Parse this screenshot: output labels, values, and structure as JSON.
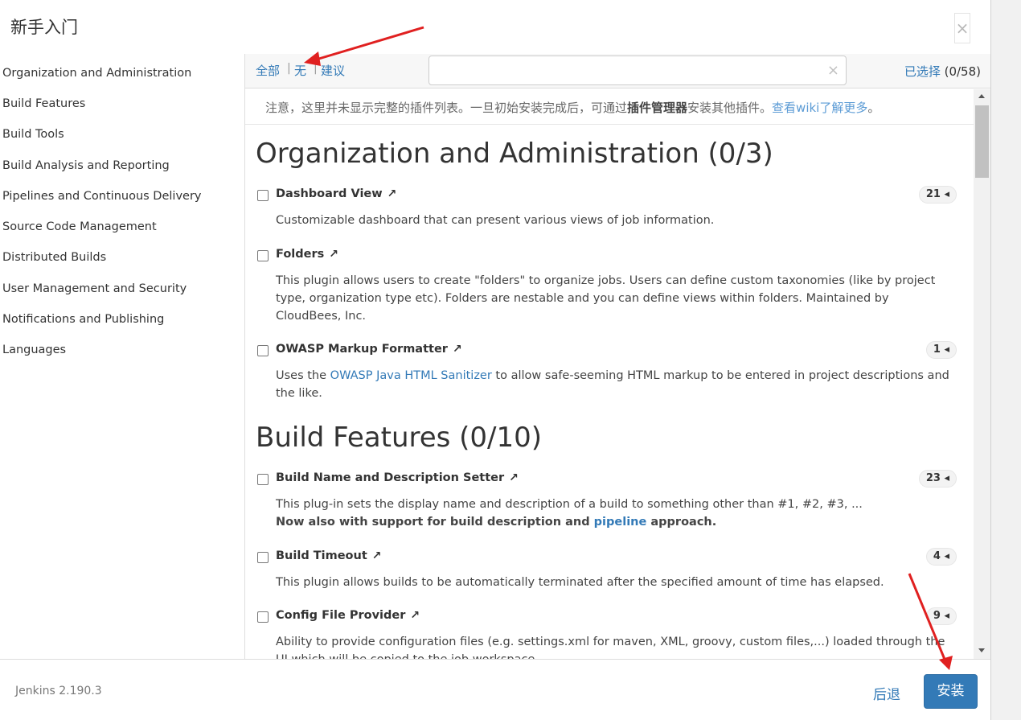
{
  "header": {
    "title": "新手入门",
    "close": "×"
  },
  "sidebar": {
    "items": [
      "Organization and Administration",
      "Build Features",
      "Build Tools",
      "Build Analysis and Reporting",
      "Pipelines and Continuous Delivery",
      "Source Code Management",
      "Distributed Builds",
      "User Management and Security",
      "Notifications and Publishing",
      "Languages"
    ]
  },
  "toolbar": {
    "all": "全部",
    "none": "无",
    "suggested": "建议",
    "sep": "|",
    "search_value": "",
    "clear": "×",
    "selected_label": "已选择",
    "selected_count": "(0/58)"
  },
  "notice": {
    "part1": "注意，这里并未显示完整的插件列表。一旦初始安装完成后，可通过",
    "bold": "插件管理器",
    "part2": "安装其他插件。",
    "link": "查看wiki了解更多",
    "end": "。"
  },
  "sections": [
    {
      "title": "Organization and Administration (0/3)"
    },
    {
      "title": "Build Features (0/10)"
    }
  ],
  "plugins": [
    {
      "name": "Dashboard View",
      "badge": "21",
      "desc": "Customizable dashboard that can present various views of job information."
    },
    {
      "name": "Folders",
      "badge": "",
      "desc": "This plugin allows users to create \"folders\" to organize jobs. Users can define custom taxonomies (like by project type, organization type etc). Folders are nestable and you can define views within folders. Maintained by CloudBees, Inc."
    },
    {
      "name": "OWASP Markup Formatter",
      "badge": "1",
      "desc_pre": "Uses the ",
      "desc_link": "OWASP Java HTML Sanitizer",
      "desc_post": " to allow safe-seeming HTML markup to be entered in project descriptions and the like."
    },
    {
      "name": "Build Name and Description Setter",
      "badge": "23",
      "desc": "This plug-in sets the display name and description of a build to something other than #1, #2, #3, ...",
      "desc2_pre": "Now also with support for build description and ",
      "desc2_link": "pipeline",
      "desc2_post": " approach."
    },
    {
      "name": "Build Timeout",
      "badge": "4",
      "desc": "This plugin allows builds to be automatically terminated after the specified amount of time has elapsed."
    },
    {
      "name": "Config File Provider",
      "badge": "9",
      "desc": "Ability to provide configuration files (e.g. settings.xml for maven, XML, groovy, custom files,...) loaded through the UI which will be copied to the job workspace."
    }
  ],
  "ext_icon": "↗",
  "badge_icon": "◂",
  "footer": {
    "version": "Jenkins 2.190.3",
    "back": "后退",
    "install": "安装"
  },
  "colors": {
    "accent": "#337ab7",
    "annotation_arrow": "#e02020"
  }
}
